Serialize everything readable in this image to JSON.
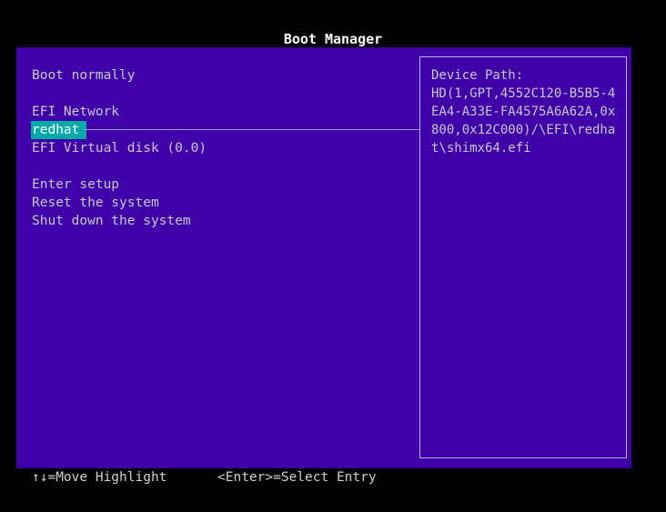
{
  "window": {
    "title": "Boot Manager"
  },
  "menu": {
    "items": [
      {
        "label": "Boot normally",
        "selected": false
      },
      {
        "label": "",
        "selected": false
      },
      {
        "label": "EFI Network",
        "selected": false
      },
      {
        "label": "redhat",
        "selected": true
      },
      {
        "label": "EFI Virtual disk (0.0)",
        "selected": false
      },
      {
        "label": "",
        "selected": false
      },
      {
        "label": "Enter setup",
        "selected": false
      },
      {
        "label": "Reset the system",
        "selected": false
      },
      {
        "label": "Shut down the system",
        "selected": false
      }
    ]
  },
  "device_path": {
    "heading": "Device Path:",
    "lines": [
      "HD(1,GPT,4552C120-B5B5-4",
      "EA4-A33E-FA4575A6A62A,0x",
      "800,0x12C000)/\\EFI\\redha",
      "t\\shimx64.efi"
    ]
  },
  "footer": {
    "move_hint": "↑↓=Move Highlight",
    "select_hint": "<Enter>=Select Entry"
  },
  "colors": {
    "background": "#000000",
    "panel": "#3f00a8",
    "highlight": "#00a8a8",
    "text": "#c8c8c8"
  }
}
